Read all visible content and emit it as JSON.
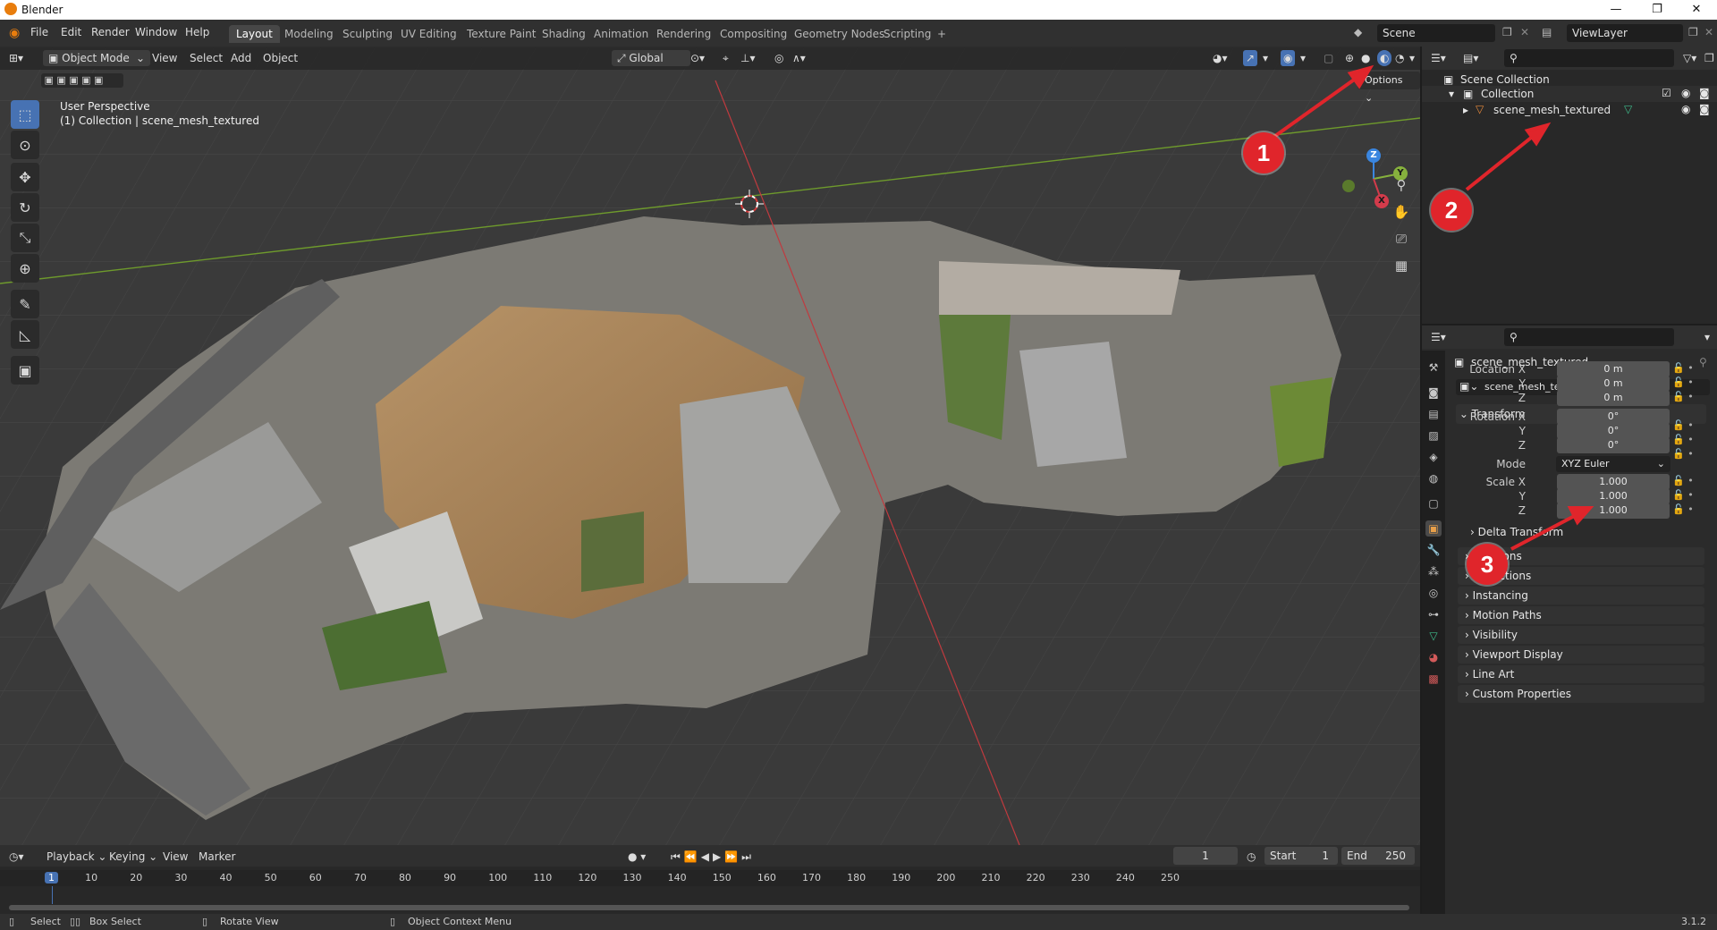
{
  "window": {
    "title": "Blender",
    "minimize": "—",
    "maximize": "❐",
    "close": "✕"
  },
  "menus": [
    "File",
    "Edit",
    "Render",
    "Window",
    "Help"
  ],
  "workspaces": [
    "Layout",
    "Modeling",
    "Sculpting",
    "UV Editing",
    "Texture Paint",
    "Shading",
    "Animation",
    "Rendering",
    "Compositing",
    "Geometry Nodes",
    "Scripting",
    "+"
  ],
  "active_workspace": "Layout",
  "scene": {
    "name": "Scene",
    "view_layer": "ViewLayer"
  },
  "viewport": {
    "mode": "Object Mode",
    "menus": [
      "View",
      "Select",
      "Add",
      "Object"
    ],
    "transform_orientation": "Global",
    "options": "Options",
    "info_line1": "User Perspective",
    "info_line2": "(1) Collection | scene_mesh_textured",
    "gizmo": {
      "x": "X",
      "y": "Y",
      "z": "Z"
    }
  },
  "outliner": {
    "scene_collection": "Scene Collection",
    "collection": "Collection",
    "object": "scene_mesh_textured"
  },
  "properties": {
    "object_name": "scene_mesh_textured",
    "data_name": "scene_mesh_textured",
    "transform_label": "Transform",
    "location_label": "Location X",
    "rotation_label": "Rotation X",
    "scale_label": "Scale X",
    "y_label": "Y",
    "z_label": "Z",
    "location": [
      "0 m",
      "0 m",
      "0 m"
    ],
    "rotation": [
      "0°",
      "0°",
      "0°"
    ],
    "mode_label": "Mode",
    "mode_value": "XYZ Euler",
    "scale": [
      "1.000",
      "1.000",
      "1.000"
    ],
    "delta": "Delta Transform",
    "panels": [
      "Relations",
      "Collections",
      "Instancing",
      "Motion Paths",
      "Visibility",
      "Viewport Display",
      "Line Art",
      "Custom Properties"
    ]
  },
  "timeline": {
    "menus": [
      "Playback",
      "Keying",
      "View",
      "Marker"
    ],
    "current_frame": "1",
    "start_label": "Start",
    "start": "1",
    "end_label": "End",
    "end": "250",
    "ticks": [
      "1",
      "10",
      "20",
      "30",
      "40",
      "50",
      "60",
      "70",
      "80",
      "90",
      "100",
      "110",
      "120",
      "130",
      "140",
      "150",
      "160",
      "170",
      "180",
      "190",
      "200",
      "210",
      "220",
      "230",
      "240",
      "250"
    ]
  },
  "statusbar": {
    "select": "Select",
    "box_select": "Box Select",
    "rotate": "Rotate View",
    "context": "Object Context Menu",
    "version": "3.1.2"
  },
  "annotations": [
    "1",
    "2",
    "3"
  ],
  "colors": {
    "accent": "#4772b3",
    "annotation": "#e0252b",
    "x_axis": "#d33b4b",
    "y_axis": "#86b13d",
    "z_axis": "#3a86e0"
  }
}
